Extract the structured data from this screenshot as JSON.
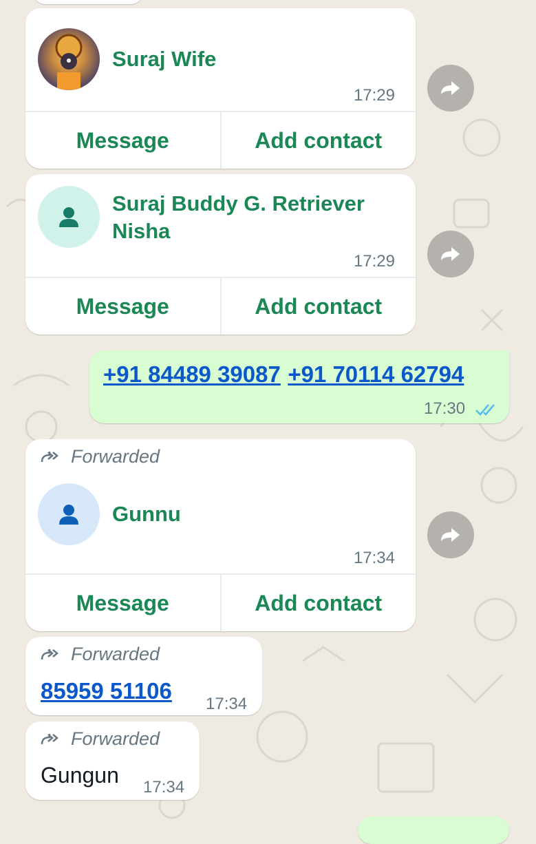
{
  "colors": {
    "chat_bg": "#efeae2",
    "bubble_in": "#ffffff",
    "bubble_out": "#d9fdd3",
    "accent_green": "#1b8755",
    "link_blue": "#0a58ca",
    "meta_grey": "#667781",
    "read_ticks": "#53bdeb"
  },
  "messages": [
    {
      "type": "contact_card",
      "name": "Suraj Wife",
      "avatar": "photo-avatar",
      "time": "17:29",
      "actions": [
        "Message",
        "Add contact"
      ]
    },
    {
      "type": "contact_card",
      "name_line1": "Suraj Buddy G. Retriever",
      "name_line2": "Nisha",
      "avatar": "person-icon",
      "time": "17:29",
      "actions": [
        "Message",
        "Add contact"
      ]
    },
    {
      "type": "outgoing_text",
      "phone_1": "+91 84489 39087",
      "phone_2": "+91 70114 62794",
      "time": "17:30",
      "status_icon": "double-check-icon"
    },
    {
      "type": "contact_card",
      "forwarded_label": "Forwarded",
      "name": "Gunnu",
      "avatar": "person-icon",
      "time": "17:34",
      "actions": [
        "Message",
        "Add contact"
      ]
    },
    {
      "type": "forwarded_text",
      "forwarded_label": "Forwarded",
      "text": "85959 51106",
      "time": "17:34"
    },
    {
      "type": "forwarded_text",
      "forwarded_label": "Forwarded",
      "text": "Gungun",
      "time": "17:34"
    }
  ]
}
